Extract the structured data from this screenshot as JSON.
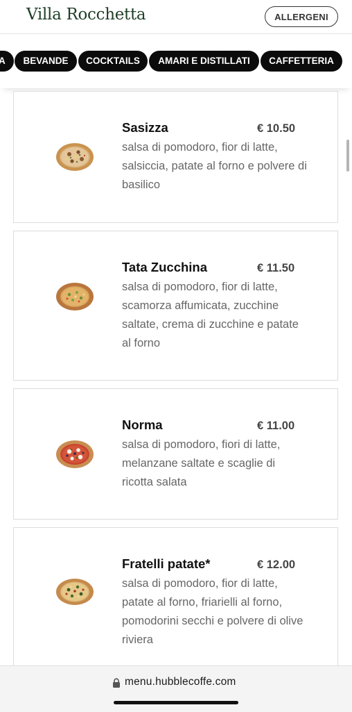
{
  "header": {
    "brand": "Villa Rocchetta",
    "allergeni_label": "ALLERGENI"
  },
  "categories": {
    "items": [
      {
        "label": "A"
      },
      {
        "label": "BEVANDE"
      },
      {
        "label": "COCKTAILS"
      },
      {
        "label": "AMARI E DISTILLATI"
      },
      {
        "label": "CAFFETTERIA"
      }
    ]
  },
  "menu": {
    "items": [
      {
        "name": "Sasizza",
        "price": "€ 10.50",
        "description": "salsa di pomodoro, fior di latte, salsiccia, patate al forno e polvere di basilico",
        "image": "pizza-sasizza"
      },
      {
        "name": "Tata Zucchina",
        "price": "€ 11.50",
        "description": "salsa di pomodoro, fior di latte, scamorza affumicata, zucchine saltate, crema di zucchine e patate al forno",
        "image": "pizza-tata-zucchina"
      },
      {
        "name": "Norma",
        "price": "€ 11.00",
        "description": "salsa di pomodoro, fiori di latte, melanzane saltate e scaglie di ricotta salata",
        "image": "pizza-norma"
      },
      {
        "name": "Fratelli patate*",
        "price": "€ 12.00",
        "description": "salsa di pomodoro, fior di latte, patate al forno, friarielli al forno, pomodorini secchi e polvere di olive riviera",
        "image": "pizza-fratelli-patate"
      }
    ]
  },
  "browser": {
    "url": "menu.hubblecoffe.com",
    "lock_icon": "lock-icon"
  },
  "colors": {
    "brand": "#1f3f27",
    "tab_background": "#0b0b0b",
    "tab_text": "#ffffff",
    "price_text": "#444444",
    "description_text": "#666666"
  }
}
